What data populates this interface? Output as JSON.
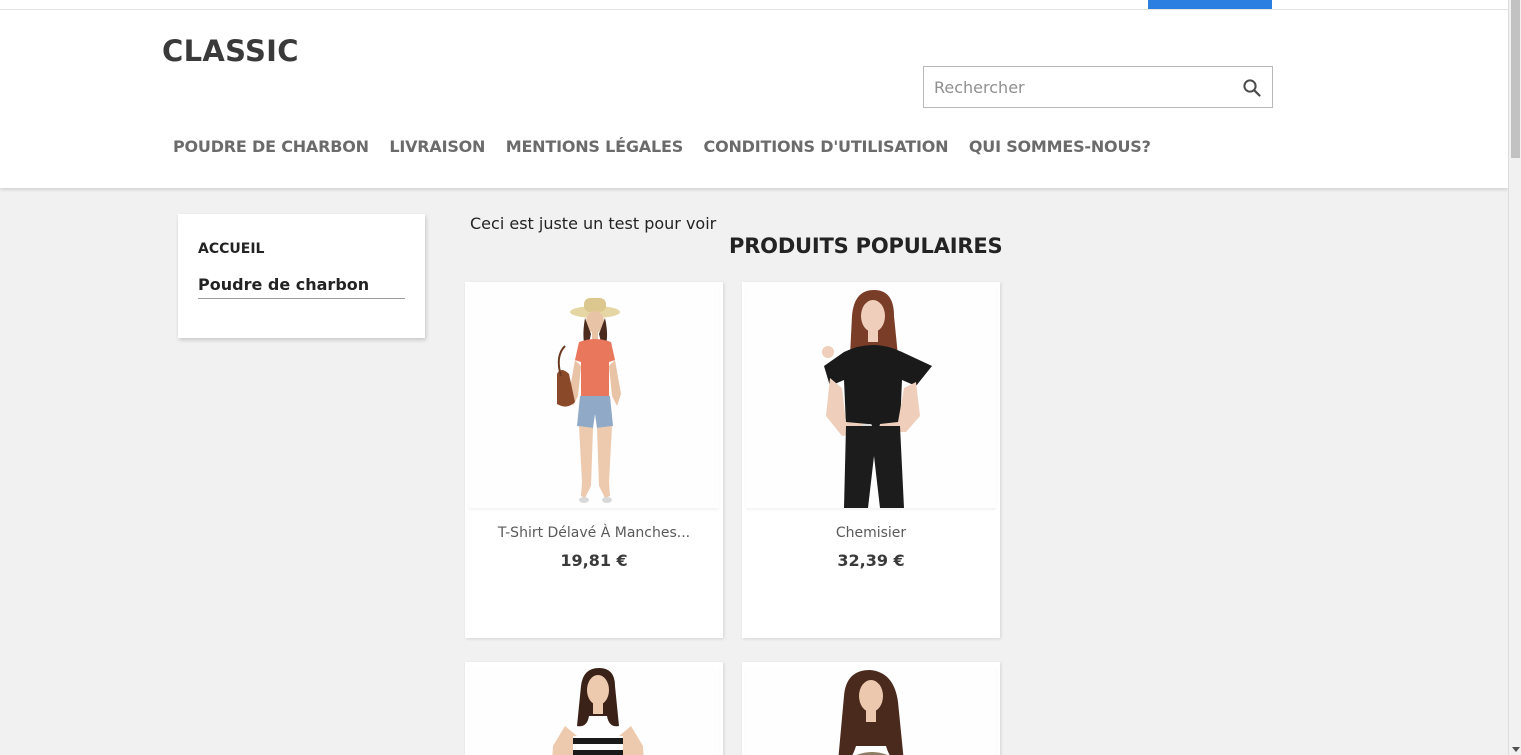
{
  "header": {
    "logo": "CLASSIC",
    "search_placeholder": "Rechercher",
    "nav": [
      {
        "label": "POUDRE DE CHARBON"
      },
      {
        "label": "LIVRAISON"
      },
      {
        "label": "MENTIONS LÉGALES"
      },
      {
        "label": "CONDITIONS D'UTILISATION"
      },
      {
        "label": "QUI SOMMES-NOUS?"
      }
    ]
  },
  "sidebar": {
    "home_label": "ACCUEIL",
    "category_label": "Poudre de charbon"
  },
  "main": {
    "intro_text": "Ceci est juste un test pour voir",
    "section_title": "PRODUITS POPULAIRES",
    "products": [
      {
        "name": "T-Shirt Délavé À Manches...",
        "price": "19,81 €"
      },
      {
        "name": "Chemisier",
        "price": "32,39 €"
      },
      {
        "name": "",
        "price": ""
      },
      {
        "name": "",
        "price": ""
      }
    ]
  },
  "colors": {
    "accent": "#2b7fe0",
    "background": "#f1f1f1"
  }
}
